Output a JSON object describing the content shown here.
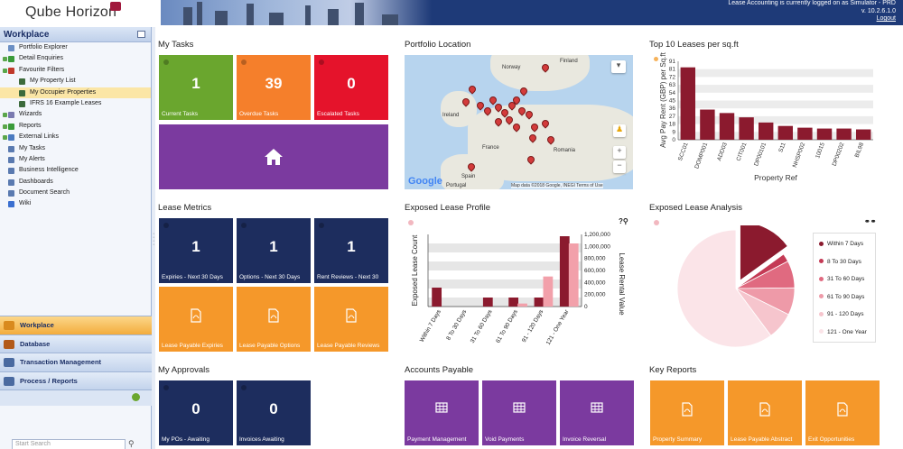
{
  "header": {
    "logo_text": "Qube Horizon",
    "login_line": "Lease Accounting is currently logged on as Simulator - PRD",
    "version": "v. 10.2.6.1.0",
    "logout": "Logout"
  },
  "sidebar": {
    "title": "Workplace",
    "items": [
      {
        "label": "Portfolio Explorer",
        "icon": "folder-icon",
        "color": "#6b8fc4"
      },
      {
        "label": "Detail Enquiries",
        "icon": "plus-icon",
        "color": "#3a9b3a"
      },
      {
        "label": "Favourite Filters",
        "icon": "filter-icon",
        "color": "#c0392b"
      },
      {
        "label": "My Property List",
        "icon": "filter-icon",
        "color": "#3c6b3c"
      },
      {
        "label": "My Occupier Properties",
        "icon": "filter-icon",
        "color": "#3c6b3c"
      },
      {
        "label": "IFRS 16 Example Leases",
        "icon": "filter-icon",
        "color": "#3c6b3c"
      },
      {
        "label": "Wizards",
        "icon": "wizard-icon",
        "color": "#7a7ab0"
      },
      {
        "label": "Reports",
        "icon": "report-icon",
        "color": "#3a9b3a"
      },
      {
        "label": "External Links",
        "icon": "link-icon",
        "color": "#4a7ac0"
      },
      {
        "label": "My Tasks",
        "icon": "tasks-icon",
        "color": "#5a7ab0"
      },
      {
        "label": "My Alerts",
        "icon": "alert-icon",
        "color": "#5a7ab0"
      },
      {
        "label": "Business Intelligence",
        "icon": "bi-icon",
        "color": "#5a7ab0"
      },
      {
        "label": "Dashboards",
        "icon": "dashboard-icon",
        "color": "#5a7ab0"
      },
      {
        "label": "Document Search",
        "icon": "doc-search-icon",
        "color": "#5a7ab0"
      },
      {
        "label": "Wiki",
        "icon": "info-icon",
        "color": "#3a6fd0"
      }
    ],
    "nav": [
      {
        "label": "Workplace",
        "icon": "workplace-icon"
      },
      {
        "label": "Database",
        "icon": "database-icon"
      },
      {
        "label": "Transaction Management",
        "icon": "transaction-icon"
      },
      {
        "label": "Process / Reports",
        "icon": "process-icon"
      }
    ],
    "search_placeholder": "Start Search"
  },
  "panels": {
    "my_tasks": {
      "title": "My Tasks",
      "tiles": [
        {
          "value": "1",
          "label": "Current Tasks"
        },
        {
          "value": "39",
          "label": "Overdue Tasks"
        },
        {
          "value": "0",
          "label": "Escalated Tasks"
        }
      ]
    },
    "portfolio_location": {
      "title": "Portfolio Location",
      "labels": {
        "norway": "Norway",
        "finland": "Finland",
        "ireland": "Ireland",
        "france": "France",
        "romania": "Romania",
        "spain": "Spain",
        "portugal": "Portugal"
      },
      "google": "Google",
      "attribution": "Map data ©2018 Google, INEGI   Terms of Use"
    },
    "top10": {
      "title": "Top 10 Leases per sq.ft"
    },
    "lease_metrics": {
      "title": "Lease Metrics",
      "tiles": [
        {
          "value": "1",
          "label": "Expiries - Next 30 Days"
        },
        {
          "value": "1",
          "label": "Options - Next 30 Days"
        },
        {
          "value": "1",
          "label": "Rent Reviews - Next 30"
        },
        {
          "label": "Lease Payable Expiries"
        },
        {
          "label": "Lease Payable Options"
        },
        {
          "label": "Lease Payable Reviews"
        }
      ]
    },
    "exposed_profile": {
      "title": "Exposed Lease Profile"
    },
    "exposed_analysis": {
      "title": "Exposed Lease Analysis"
    },
    "my_approvals": {
      "title": "My Approvals",
      "tiles": [
        {
          "value": "0",
          "label": "My POs - Awaiting"
        },
        {
          "value": "0",
          "label": "Invoices Awaiting"
        }
      ]
    },
    "accounts_payable": {
      "title": "Accounts Payable",
      "tiles": [
        {
          "label": "Payment Management"
        },
        {
          "label": "Void Payments"
        },
        {
          "label": "Invoice Reversal"
        }
      ]
    },
    "key_reports": {
      "title": "Key Reports",
      "tiles": [
        {
          "label": "Property Summary"
        },
        {
          "label": "Lease Payable Abstract"
        },
        {
          "label": "Exit Opportunities"
        }
      ]
    },
    "help_icons": "?⚲"
  },
  "chart_data": [
    {
      "type": "bar",
      "title": "Top 10 Leases per sq.ft",
      "xlabel": "Property Ref",
      "ylabel": "Avg Pay Rent (GBP) per Sq.ft",
      "categories": [
        "SCC01",
        "DOMP001",
        "ADD03",
        "CIT001",
        "DP00101",
        "S11",
        "NHSP002",
        "10015",
        "DP00202",
        "BIL98"
      ],
      "values": [
        84,
        35,
        31,
        26,
        20,
        16,
        14,
        13,
        13,
        12
      ],
      "ylim": [
        0,
        91
      ],
      "ytick_labels": [
        "0",
        "9",
        "18",
        "27",
        "36",
        "45",
        "54",
        "63",
        "72",
        "81",
        "91"
      ],
      "color": "#8b1a2e"
    },
    {
      "type": "bar",
      "title": "Exposed Lease Profile",
      "categories": [
        "Within 7 Days",
        "8 To 30 Days",
        "31 To 60 Days",
        "61 To 90 Days",
        "91 - 120 Days",
        "121 - One Year"
      ],
      "ylabel": "Exposed Lease Count",
      "y2label": "Lease Rental Value",
      "ylim": [
        0,
        8
      ],
      "y2lim": [
        0,
        1200000
      ],
      "y2_ticks": [
        "0",
        "200,000",
        "400,000",
        "600,000",
        "800,000",
        "1,000,000",
        "1,200,000"
      ],
      "series": [
        {
          "name": "Exposed Lease Count",
          "values": [
            2.1,
            0,
            1.0,
            1.0,
            1.0,
            7.8
          ],
          "color": "#8b1a2e"
        },
        {
          "name": "Lease Rental Value",
          "values": [
            0,
            0,
            0,
            50000,
            500000,
            1050000
          ],
          "color": "#f2a0aa"
        }
      ]
    },
    {
      "type": "pie",
      "title": "Exposed Lease Analysis",
      "labels": [
        "Within 7 Days",
        "8 To 30 Days",
        "31 To 60 Days",
        "61 To 90 Days",
        "91 - 120 Days",
        "121 - One Year"
      ],
      "values": [
        2,
        0.3,
        1,
        1,
        1,
        8
      ],
      "colors": [
        "#8b1a2e",
        "#c43a55",
        "#e06a80",
        "#ee9aa8",
        "#f6c5cd",
        "#fbe4e8"
      ]
    }
  ]
}
